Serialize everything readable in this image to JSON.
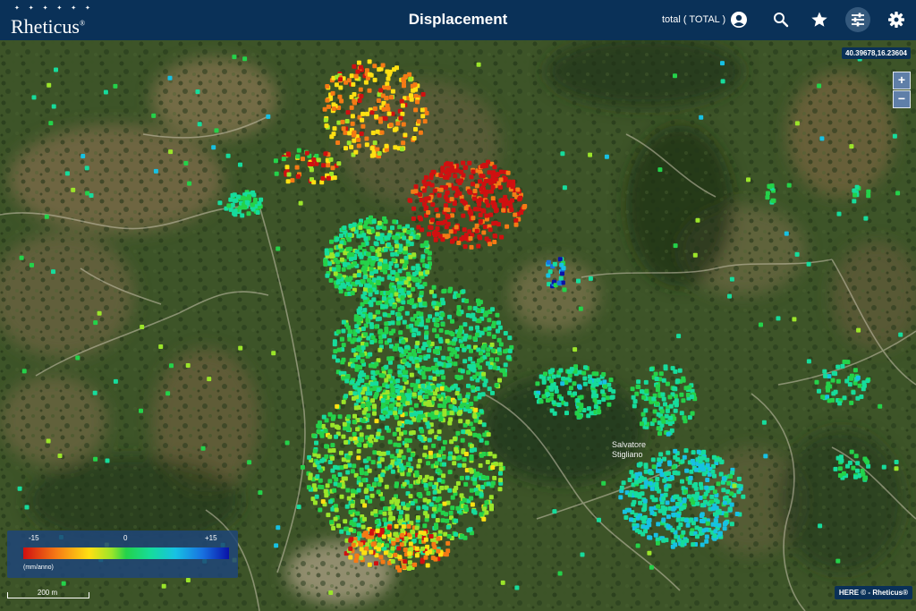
{
  "header": {
    "logo": "Rheticus",
    "logo_mark": "®",
    "title": "Displacement",
    "layer_label": "total ( TOTAL )",
    "icons": [
      "user-icon",
      "search-icon",
      "star-icon",
      "sliders-icon",
      "gear-icon"
    ]
  },
  "map": {
    "coordinates": "40.39678,16.23604",
    "zoom_in": "+",
    "zoom_out": "−",
    "scale_label": "200 m",
    "attribution": "HERE © - Rheticus®",
    "map_label_lines": [
      "Salvatore",
      "Stigliano"
    ]
  },
  "legend": {
    "tick_min": "-15",
    "tick_mid": "0",
    "tick_max": "+15",
    "unit": "(mm/anno)",
    "colors": [
      "#d01010",
      "#f57a15",
      "#ffe012",
      "#9be52a",
      "#24d24a",
      "#16dc9c",
      "#17c1e3",
      "#1872e0",
      "#0a12a7"
    ]
  },
  "colors": {
    "header_bg": "#0a3158",
    "active_icon_bg": "#34597d"
  }
}
